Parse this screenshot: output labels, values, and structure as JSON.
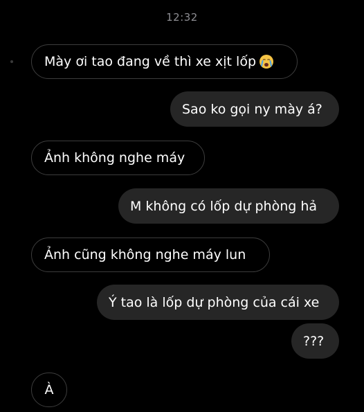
{
  "chat": {
    "timestamp": "12:32",
    "messages": [
      {
        "side": "incoming",
        "text": "Mày ơi tao đang về thì xe xịt lốp",
        "emoji": "crying-face"
      },
      {
        "side": "outgoing",
        "text": "Sao ko gọi ny mày á?"
      },
      {
        "side": "incoming",
        "text": "Ảnh không nghe máy"
      },
      {
        "side": "outgoing",
        "text": "M không có lốp dự phòng hả"
      },
      {
        "side": "incoming",
        "text": "Ảnh cũng không nghe máy lun"
      },
      {
        "side": "outgoing",
        "text": "Ý tao là lốp dự phòng của cái xe"
      },
      {
        "side": "outgoing",
        "text": "???"
      },
      {
        "side": "incoming",
        "text": "À"
      }
    ]
  },
  "colors": {
    "background": "#000000",
    "incoming_border": "#3d3d3d",
    "outgoing_fill": "#262626",
    "text": "#ffffff",
    "timestamp": "#8e8e93"
  }
}
